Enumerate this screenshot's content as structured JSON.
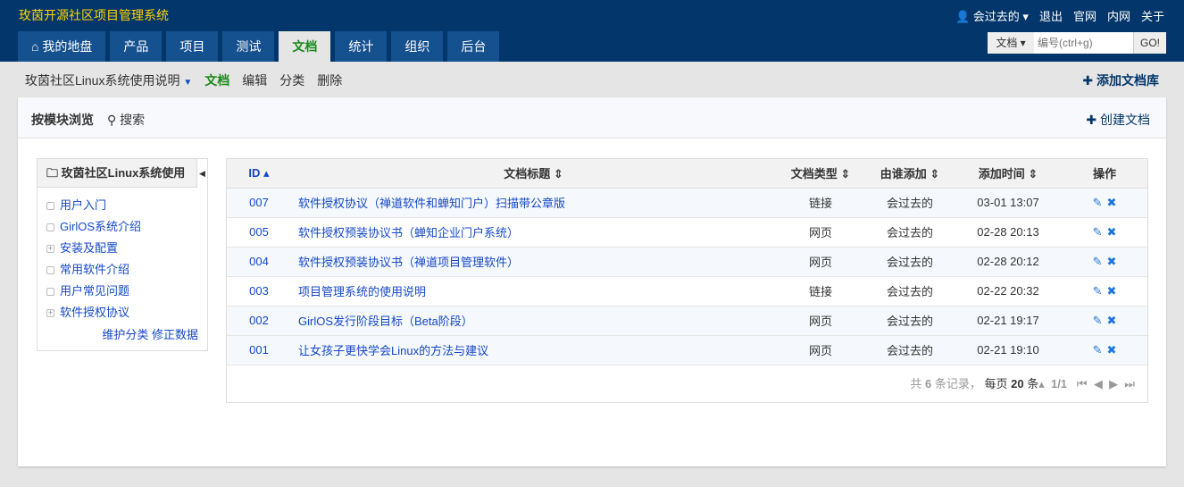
{
  "app": {
    "title": "玫茵开源社区项目管理系统"
  },
  "topnav": {
    "user": "会过去的",
    "logout": "退出",
    "official": "官网",
    "intranet": "内网",
    "about": "关于"
  },
  "tabs": [
    "我的地盘",
    "产品",
    "项目",
    "测试",
    "文档",
    "统计",
    "组织",
    "后台"
  ],
  "search": {
    "type": "文档",
    "placeholder": "编号(ctrl+g)",
    "go": "GO!"
  },
  "subnav": {
    "lib": "玫茵社区Linux系统使用说明",
    "items": [
      "文档",
      "编辑",
      "分类",
      "删除"
    ],
    "add_lib": "添加文档库"
  },
  "panel": {
    "browse": "按模块浏览",
    "search": "搜索",
    "create": "创建文档"
  },
  "tree": {
    "title": "玫茵社区Linux系统使用",
    "items": [
      {
        "label": "用户入门",
        "exp": false
      },
      {
        "label": "GirlOS系统介绍",
        "exp": false
      },
      {
        "label": "安装及配置",
        "exp": true
      },
      {
        "label": "常用软件介绍",
        "exp": false
      },
      {
        "label": "用户常见问题",
        "exp": false
      },
      {
        "label": "软件授权协议",
        "exp": true
      }
    ],
    "maintain": "维护分类",
    "fix": "修正数据"
  },
  "table": {
    "headers": [
      "ID",
      "文档标题",
      "文档类型",
      "由谁添加",
      "添加时间",
      "操作"
    ],
    "rows": [
      {
        "id": "007",
        "title": "软件授权协议（禅道软件和蝉知门户）扫描带公章版",
        "type": "链接",
        "by": "会过去的",
        "time": "03-01 13:07"
      },
      {
        "id": "005",
        "title": "软件授权预装协议书（蝉知企业门户系统）",
        "type": "网页",
        "by": "会过去的",
        "time": "02-28 20:13"
      },
      {
        "id": "004",
        "title": "软件授权预装协议书（禅道项目管理软件）",
        "type": "网页",
        "by": "会过去的",
        "time": "02-28 20:12"
      },
      {
        "id": "003",
        "title": "项目管理系统的使用说明",
        "type": "链接",
        "by": "会过去的",
        "time": "02-22 20:32"
      },
      {
        "id": "002",
        "title": "GirlOS发行阶段目标（Beta阶段）",
        "type": "网页",
        "by": "会过去的",
        "time": "02-21 19:17"
      },
      {
        "id": "001",
        "title": "让女孩子更快学会Linux的方法与建议",
        "type": "网页",
        "by": "会过去的",
        "time": "02-21 19:10"
      }
    ]
  },
  "pager": {
    "total_pre": "共",
    "total": "6",
    "total_post": "条记录，",
    "per_pre": "每页",
    "per": "20",
    "per_post": "条",
    "page": "1/1"
  }
}
